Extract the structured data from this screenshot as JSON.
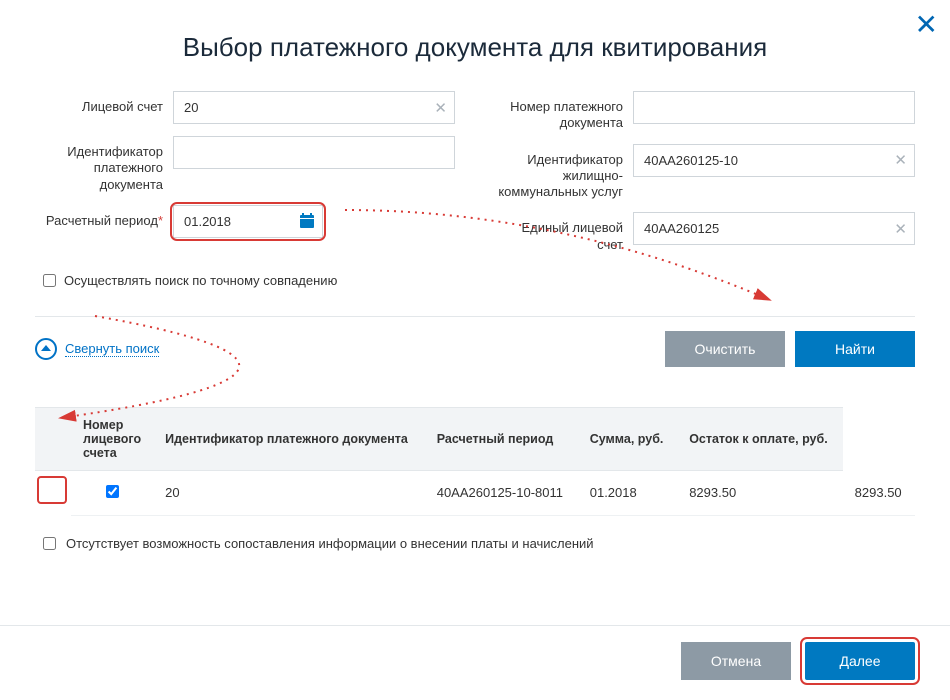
{
  "title": "Выбор платежного документа для квитирования",
  "labels": {
    "account": "Лицевой счет",
    "doc_id": "Идентификатор платежного документа",
    "period": "Расчетный период",
    "doc_number": "Номер платежного документа",
    "service_id": "Идентификатор жилищно-коммунальных услуг",
    "unified_account": "Единый лицевой счет",
    "exact_search": "Осуществлять поиск по точному совпадению",
    "collapse": "Свернуть поиск",
    "clear": "Очистить",
    "find": "Найти",
    "no_match": "Отсутствует возможность сопоставления информации о внесении платы и начислений",
    "cancel": "Отмена",
    "next": "Далее"
  },
  "values": {
    "account": "20",
    "doc_id": "",
    "period": "01.2018",
    "doc_number": "",
    "service_id": "40АА260125-10",
    "unified_account": "40АА260125"
  },
  "table": {
    "headers": {
      "account": "Номер лицевого счета",
      "doc_id": "Идентификатор платежного документа",
      "period": "Расчетный период",
      "sum": "Сумма, руб.",
      "remainder": "Остаток к оплате, руб."
    },
    "rows": [
      {
        "checked": true,
        "account": "20",
        "doc_id": "40АА260125-10-8011",
        "period": "01.2018",
        "sum": "8293.50",
        "remainder": "8293.50"
      }
    ]
  }
}
